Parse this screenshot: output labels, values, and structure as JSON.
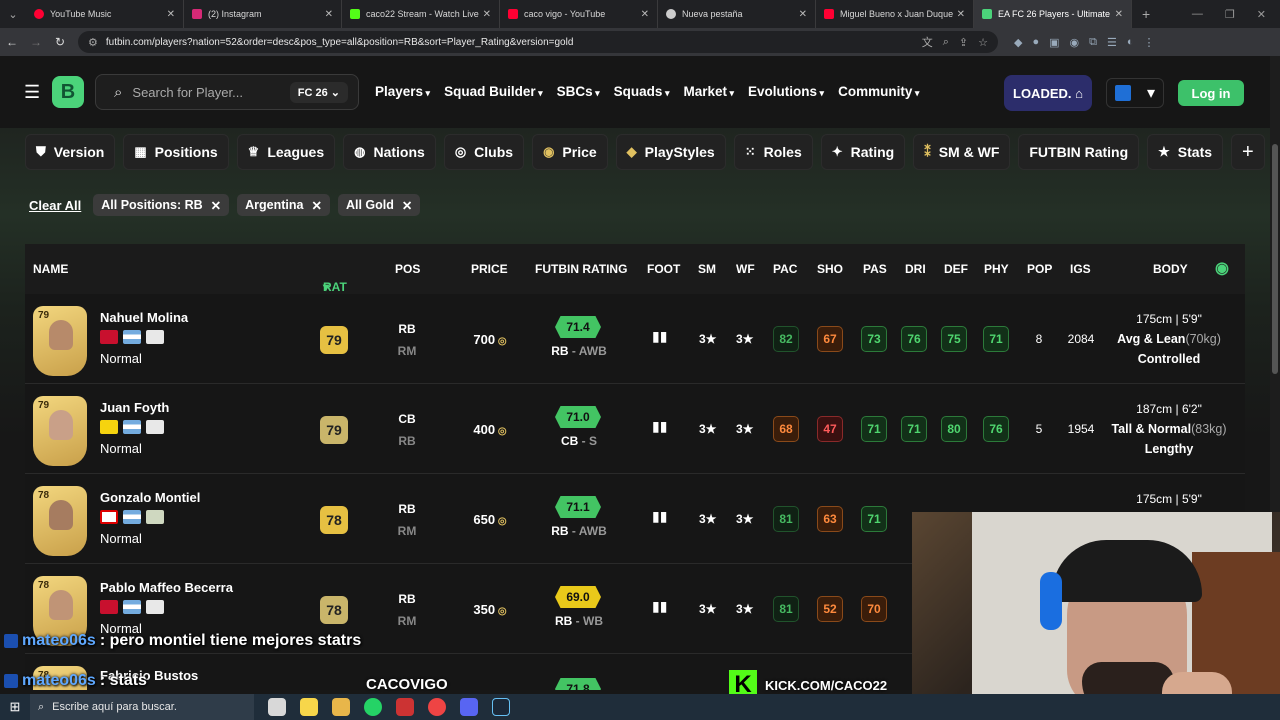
{
  "browser": {
    "tabs": [
      {
        "title": "YouTube Music",
        "color": "#ff0033"
      },
      {
        "title": "(2) Instagram",
        "color": "#d62976"
      },
      {
        "title": "caco22 Stream - Watch Live on",
        "color": "#53fc18"
      },
      {
        "title": "caco vigo - YouTube",
        "color": "#ff0033"
      },
      {
        "title": "Nueva pestaña",
        "color": "#cccccc"
      },
      {
        "title": "Miguel Bueno x Juan Duque - S",
        "color": "#ff0033"
      },
      {
        "title": "EA FC 26 Players - Ultimate Tea",
        "color": "#4bd37a"
      }
    ],
    "url": "futbin.com/players?nation=52&order=desc&pos_type=all&position=RB&sort=Player_Rating&version=gold"
  },
  "site": {
    "search_placeholder": "Search for Player...",
    "game_version": "FC 26",
    "nav": [
      "Players",
      "Squad Builder",
      "SBCs",
      "Squads",
      "Market",
      "Evolutions",
      "Community"
    ],
    "loaded_label": "LOADED.",
    "login_label": "Log in"
  },
  "filters": {
    "buttons": [
      {
        "label": "Version",
        "icon": "shield-icon"
      },
      {
        "label": "Positions",
        "icon": "grid-icon"
      },
      {
        "label": "Leagues",
        "icon": "trophy-icon"
      },
      {
        "label": "Nations",
        "icon": "globe-icon"
      },
      {
        "label": "Clubs",
        "icon": "badge-icon"
      },
      {
        "label": "Price",
        "icon": "coin-icon"
      },
      {
        "label": "PlayStyles",
        "icon": "diamond-icon"
      },
      {
        "label": "Roles",
        "icon": "dots-icon"
      },
      {
        "label": "Rating",
        "icon": "sparkle-icon"
      },
      {
        "label": "SM & WF",
        "icon": "foot-icon"
      },
      {
        "label": "FUTBIN Rating",
        "icon": ""
      },
      {
        "label": "Stats",
        "icon": "star-icon"
      }
    ],
    "clear_all": "Clear All",
    "active_chips": [
      "All Positions: RB",
      "Argentina",
      "All Gold"
    ]
  },
  "table": {
    "headers": [
      "NAME",
      "RAT",
      "POS",
      "PRICE",
      "FUTBIN RATING",
      "FOOT",
      "SM",
      "WF",
      "PAC",
      "SHO",
      "PAS",
      "DRI",
      "DEF",
      "PHY",
      "POP",
      "IGS",
      "BODY"
    ],
    "rows": [
      {
        "name": "Nahuel Molina",
        "card_rating": "79",
        "type": "Normal",
        "rating": "79",
        "pos": "RB",
        "alt_pos": "RM",
        "price": "700",
        "futbin": "71.4",
        "futbin_pos": "RB",
        "futbin_role": "AWB",
        "sm": "3★",
        "wf": "3★",
        "stats": [
          "82",
          "67",
          "73",
          "76",
          "75",
          "71"
        ],
        "pop": "8",
        "igs": "2084",
        "height": "175cm | 5'9\"",
        "build": "Avg & Lean",
        "weight": "(70kg)",
        "accel": "Controlled"
      },
      {
        "name": "Juan Foyth",
        "card_rating": "79",
        "type": "Normal",
        "rating": "79",
        "pos": "CB",
        "alt_pos": "RB",
        "price": "400",
        "futbin": "71.0",
        "futbin_pos": "CB",
        "futbin_role": "S",
        "sm": "3★",
        "wf": "3★",
        "stats": [
          "68",
          "47",
          "71",
          "71",
          "80",
          "76"
        ],
        "pop": "5",
        "igs": "1954",
        "height": "187cm | 6'2\"",
        "build": "Tall & Normal",
        "weight": "(83kg)",
        "accel": "Lengthy"
      },
      {
        "name": "Gonzalo Montiel",
        "card_rating": "78",
        "type": "Normal",
        "rating": "78",
        "pos": "RB",
        "alt_pos": "RM",
        "price": "650",
        "futbin": "71.1",
        "futbin_pos": "RB",
        "futbin_role": "AWB",
        "sm": "3★",
        "wf": "3★",
        "stats": [
          "81",
          "63",
          "71"
        ],
        "height": "175cm | 5'9\""
      },
      {
        "name": "Pablo Maffeo Becerra",
        "card_rating": "78",
        "type": "Normal",
        "rating": "78",
        "pos": "RB",
        "alt_pos": "RM",
        "price": "350",
        "futbin": "69.0",
        "futbin_pos": "RB",
        "futbin_role": "WB",
        "sm": "3★",
        "wf": "3★",
        "stats": [
          "81",
          "52",
          "70"
        ]
      },
      {
        "name": "Fabricio Bustos",
        "card_rating": "78",
        "futbin": "71.8"
      }
    ]
  },
  "overlay": {
    "chat": [
      {
        "user": "mateo06s",
        "message": ": pero montiel tiene mejores statrs"
      },
      {
        "user": "mateo06s",
        "message": ": stats"
      }
    ],
    "brand": "CACOVIGO",
    "kick": "KICK.COM/CACO22"
  },
  "taskbar": {
    "search_placeholder": "Escribe aquí para buscar."
  }
}
